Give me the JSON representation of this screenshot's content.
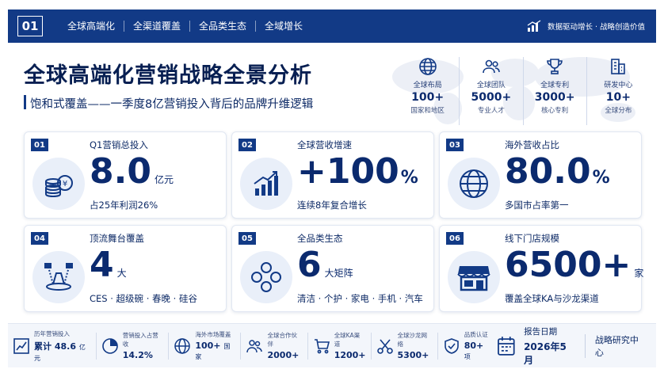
{
  "topbar": {
    "number": "01",
    "tabs": [
      "全球高端化",
      "全渠道覆盖",
      "全品类生态",
      "全域增长"
    ],
    "slogan": "数据驱动增长 · 战略创造价值"
  },
  "header": {
    "title": "全球高端化营销战略全景分析",
    "subtitle": "饱和式覆盖——一季度8亿营销投入背后的品牌升维逻辑"
  },
  "stats": [
    {
      "icon": "globe-icon",
      "label": "全球布局",
      "value": "100+",
      "sub": "国家和地区"
    },
    {
      "icon": "team-icon",
      "label": "全球团队",
      "value": "5000+",
      "sub": "专业人才"
    },
    {
      "icon": "trophy-icon",
      "label": "全球专利",
      "value": "3000+",
      "sub": "核心专利"
    },
    {
      "icon": "building-icon",
      "label": "研发中心",
      "value": "10+",
      "sub": "全球分布"
    }
  ],
  "cards": [
    {
      "badge": "01",
      "title": "Q1营销总投入",
      "value": "8.0",
      "unit": "亿元",
      "desc": "占25年利润26%",
      "icon": "coins-icon"
    },
    {
      "badge": "02",
      "title": "全球营收增速",
      "value": "+100",
      "unit": "%",
      "desc": "连续8年复合增长",
      "icon": "bar-growth-icon"
    },
    {
      "badge": "03",
      "title": "海外营收占比",
      "value": "80.0",
      "unit": "%",
      "desc": "多国市占率第一",
      "icon": "globe-icon"
    },
    {
      "badge": "04",
      "title": "顶流舞台覆盖",
      "value": "4",
      "unit": "大",
      "desc": "CES · 超级碗 · 春晚 · 硅谷",
      "icon": "stage-icon"
    },
    {
      "badge": "05",
      "title": "全品类生态",
      "value": "6",
      "unit": "大矩阵",
      "desc": "清洁 · 个护 · 家电 · 手机 · 汽车",
      "icon": "ecosystem-icon"
    },
    {
      "badge": "06",
      "title": "线下门店规模",
      "value": "6500+",
      "unit": "家",
      "desc": "覆盖全球KA与沙龙渠道",
      "icon": "store-icon"
    }
  ],
  "bottom": [
    {
      "icon": "chart-icon",
      "label": "历年营销投入",
      "value": "累计 48.6",
      "unit": "亿元"
    },
    {
      "icon": "pie-icon",
      "label": "营销投入占营收",
      "value": "14.2%",
      "unit": ""
    },
    {
      "icon": "globe-icon",
      "label": "海外市场覆盖",
      "value": "100+",
      "unit": "国家"
    },
    {
      "icon": "partner-icon",
      "label": "全球合作伙伴",
      "value": "2000+",
      "unit": ""
    },
    {
      "icon": "cart-icon",
      "label": "全球KA渠道",
      "value": "1200+",
      "unit": ""
    },
    {
      "icon": "scissors-icon",
      "label": "全球沙龙网络",
      "value": "5300+",
      "unit": ""
    },
    {
      "icon": "shield-icon",
      "label": "品质认证",
      "value": "80+",
      "unit": "项"
    }
  ],
  "report": {
    "label": "报告日期",
    "date": "2026年5月",
    "org": "战略研究中心"
  },
  "colors": {
    "primary": "#123a86",
    "dark_text": "#071f52",
    "icon_bg": "#e9eff9"
  }
}
